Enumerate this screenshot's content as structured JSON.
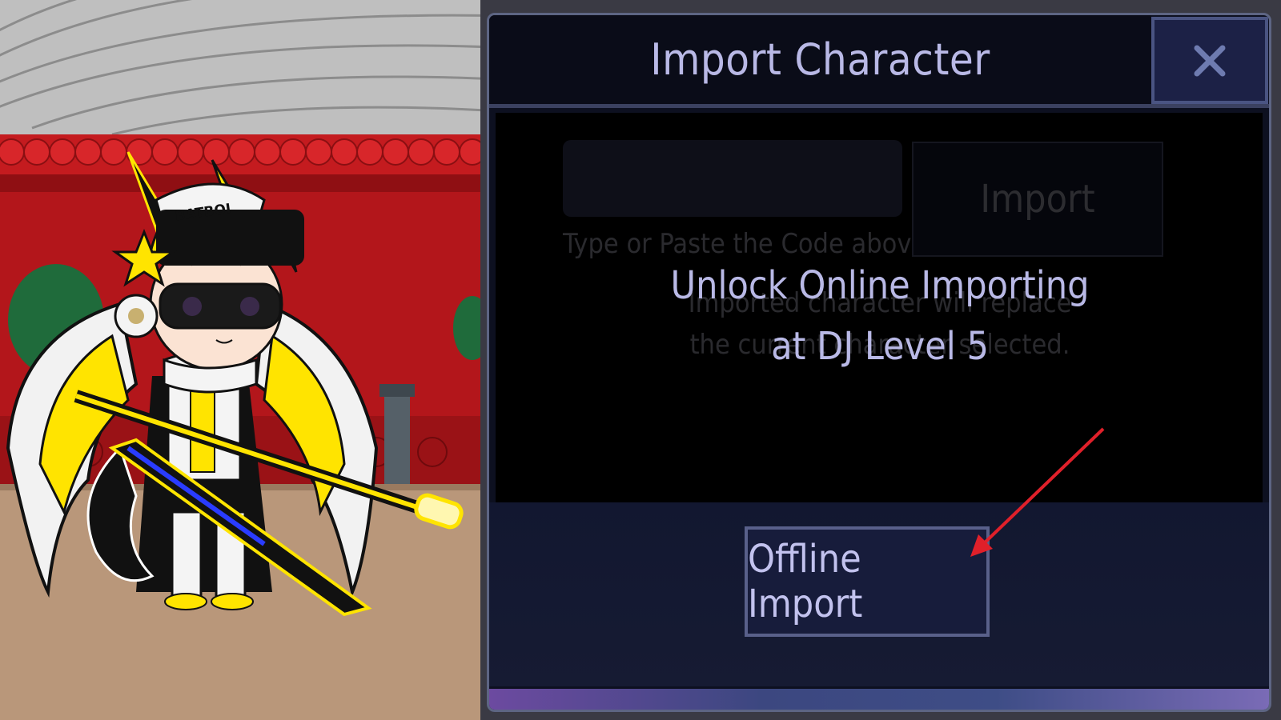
{
  "dialog": {
    "title": "Import Character",
    "close_icon": "close-x-icon"
  },
  "import_form": {
    "code_value": "",
    "code_hint": "Type or Paste the Code above",
    "import_label": "Import",
    "note_line1": "Imported character will replace",
    "note_line2": "the current character selected."
  },
  "unlock": {
    "line1": "Unlock Online Importing",
    "line2": "at DJ Level 5"
  },
  "offline_import": {
    "label": "Offline Import"
  },
  "scene": {
    "hat_text": "BATBOI",
    "character": "gacha-style-character"
  },
  "colors": {
    "dialog_bg": "#0d1020",
    "accent_text": "#b9b9e6",
    "button_bg": "#171c3b",
    "annotation_arrow": "#e0202a"
  }
}
